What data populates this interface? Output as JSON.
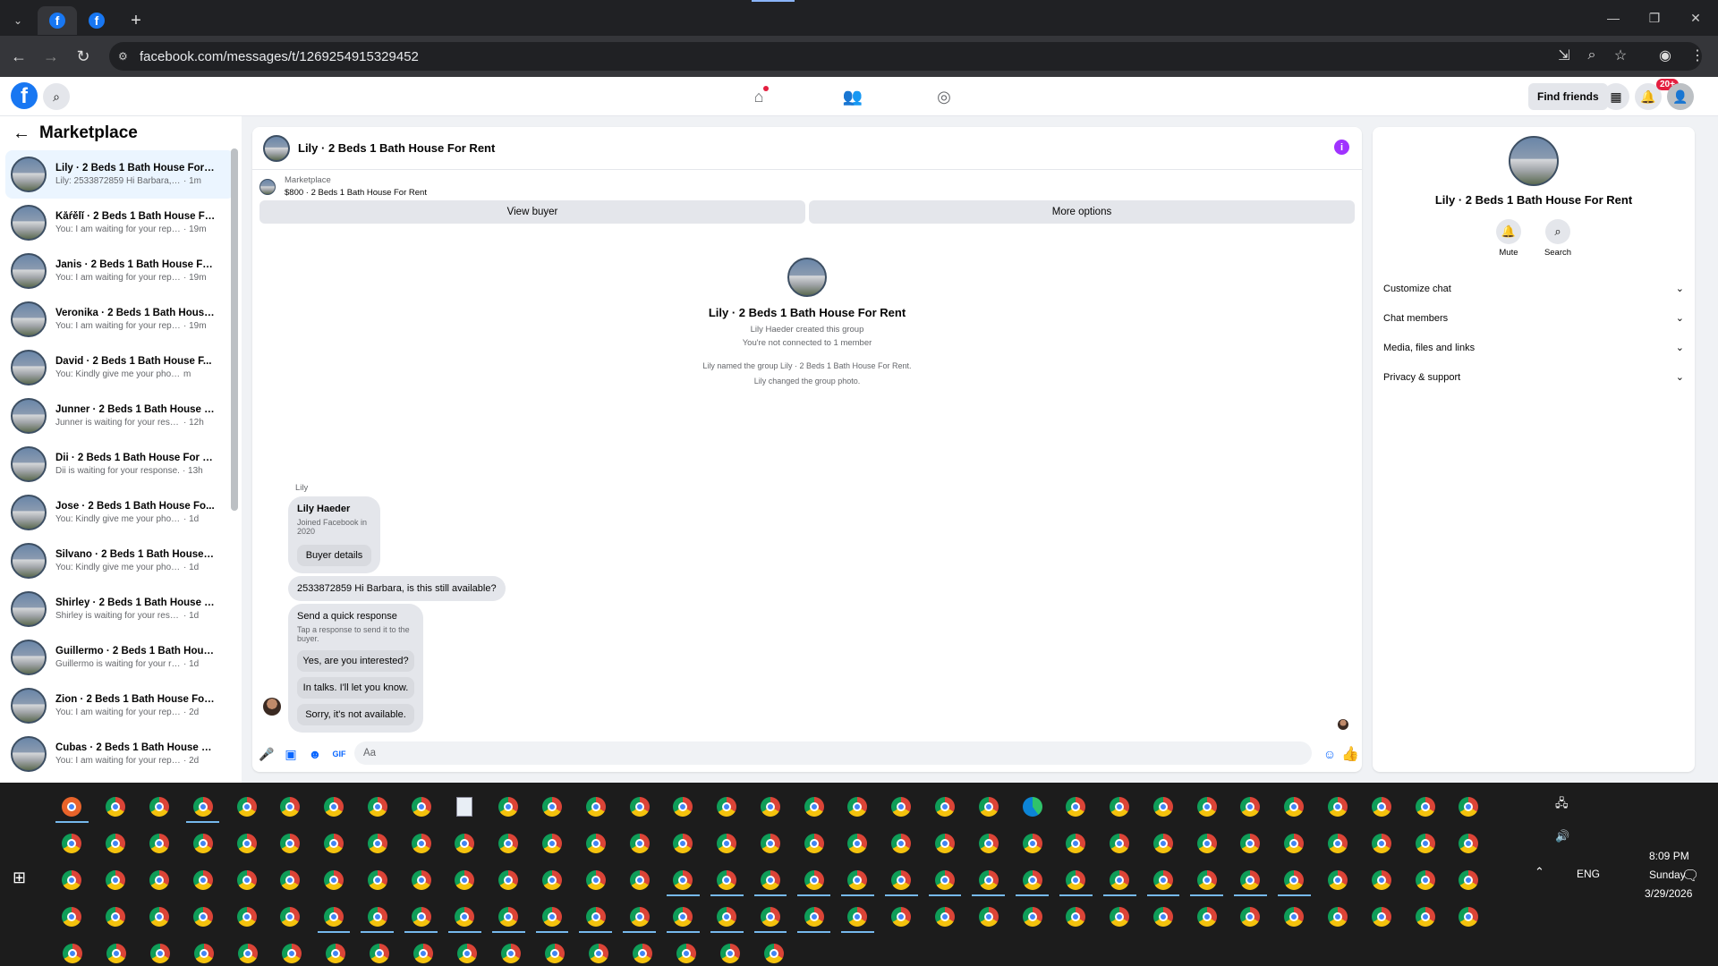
{
  "browser": {
    "url": "facebook.com/messages/t/1269254915329452",
    "new_tab": "+"
  },
  "fb": {
    "find_friends": "Find friends",
    "notif_badge": "20+"
  },
  "sidebar": {
    "title": "Marketplace",
    "conversations": [
      {
        "title": "Lily · 2 Beds 1 Bath House For R...",
        "msg": "Lily: 2533872859 Hi Barbara, is thi...",
        "time": "· 1m"
      },
      {
        "title": "Kǻŕěĺǐ · 2 Beds 1 Bath House For...",
        "msg": "You: I am waiting for your reply, ...",
        "time": "· 19m"
      },
      {
        "title": "Janis · 2 Beds 1 Bath House For ...",
        "msg": "You: I am waiting for your reply, ...",
        "time": "· 19m"
      },
      {
        "title": "Veronika · 2 Beds 1 Bath House ...",
        "msg": "You: I am waiting for your reply, ...",
        "time": "· 19m"
      },
      {
        "title": "David · 2 Beds 1 Bath House F...",
        "msg": "You: Kindly give me your phone ...",
        "time": "m"
      },
      {
        "title": "Junner · 2 Beds 1 Bath House F...",
        "msg": "Junner is waiting for your respon...",
        "time": "· 12h"
      },
      {
        "title": "Dii · 2 Beds 1 Bath House For Re...",
        "msg": "Dii is waiting for your response.",
        "time": "· 13h"
      },
      {
        "title": "Jose · 2 Beds 1 Bath House Fo...",
        "msg": "You: Kindly give me your phone...",
        "time": "· 1d"
      },
      {
        "title": "Silvano · 2 Beds 1 Bath House F...",
        "msg": "You: Kindly give me your phone n...",
        "time": "· 1d"
      },
      {
        "title": "Shirley · 2 Beds 1 Bath House F...",
        "msg": "Shirley is waiting for your response.",
        "time": "· 1d"
      },
      {
        "title": "Guillermo · 2 Beds 1 Bath Hous...",
        "msg": "Guillermo is waiting for your resp...",
        "time": "· 1d"
      },
      {
        "title": "Zion · 2 Beds 1 Bath House For ...",
        "msg": "You: I am waiting for your reply, pl...",
        "time": "· 2d"
      },
      {
        "title": "Cubas · 2 Beds 1 Bath House Fo...",
        "msg": "You: I am waiting for your reply, pl...",
        "time": "· 2d"
      }
    ]
  },
  "chat": {
    "title": "Lily · 2 Beds 1 Bath House For Rent",
    "marketplace_label": "Marketplace",
    "listing": "$800 · 2 Beds 1 Bath House For Rent",
    "view_buyer": "View buyer",
    "more_options": "More options",
    "group_name": "Lily · 2 Beds 1 Bath House For Rent",
    "created_by": "Lily Haeder created this group",
    "not_connected": "You're not connected to 1 member",
    "sys_named": "Lily named the group Lily · 2 Beds 1 Bath House For Rent.",
    "sys_photo": "Lily changed the group photo.",
    "sender": "Lily",
    "buyer_name": "Lily Haeder",
    "buyer_joined": "Joined Facebook in 2020",
    "buyer_details": "Buyer details",
    "message": "2533872859 Hi Barbara, is this still available?",
    "quick_title": "Send a quick response",
    "quick_sub": "Tap a response to send it to the buyer.",
    "quick_1": "Yes, are you interested?",
    "quick_2": "In talks. I'll let you know.",
    "quick_3": "Sorry, it's not available.",
    "composer_placeholder": "Aa"
  },
  "info_panel": {
    "name": "Lily · 2 Beds 1 Bath House For Rent",
    "mute": "Mute",
    "search": "Search",
    "sections": [
      "Customize chat",
      "Chat members",
      "Media, files and links",
      "Privacy & support"
    ]
  },
  "taskbar": {
    "lang": "ENG",
    "time": "8:09 PM",
    "day": "Sunday",
    "date": "3/29/2026"
  },
  "colors": {
    "fb_blue": "#1877f2",
    "messenger_blue": "#0866ff",
    "info_purple": "#a033ff"
  }
}
